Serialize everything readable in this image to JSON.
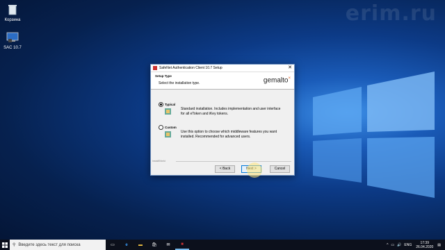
{
  "watermark": "erim.ru",
  "desktop": {
    "icons": [
      {
        "label": "Корзина",
        "icon": "recycle-bin-icon"
      },
      {
        "label": "SAC 10.7",
        "icon": "sac-shortcut-icon"
      }
    ]
  },
  "dialog": {
    "title": "SafeNet Authentication Client 10.7 Setup",
    "close": "✕",
    "header_title": "Setup Type",
    "header_subtitle": "Select the installation type.",
    "logo": "gemalto",
    "logo_mark": "×",
    "options": [
      {
        "label": "Typical",
        "selected": true,
        "description": "Standard installation. Includes implementation and user interface for all eToken and iKey tokens."
      },
      {
        "label": "Custom",
        "selected": false,
        "description": "Use this option to choose which middleware features you want installed. Recommended for advanced users."
      }
    ],
    "footer_brand": "InstallShield",
    "buttons": {
      "back": "< Back",
      "next": "Next >",
      "cancel": "Cancel"
    }
  },
  "taskbar": {
    "search_placeholder": "Введите здесь текст для поиска",
    "language": "ENG",
    "time": "17:39",
    "date": "26.04.2020"
  }
}
